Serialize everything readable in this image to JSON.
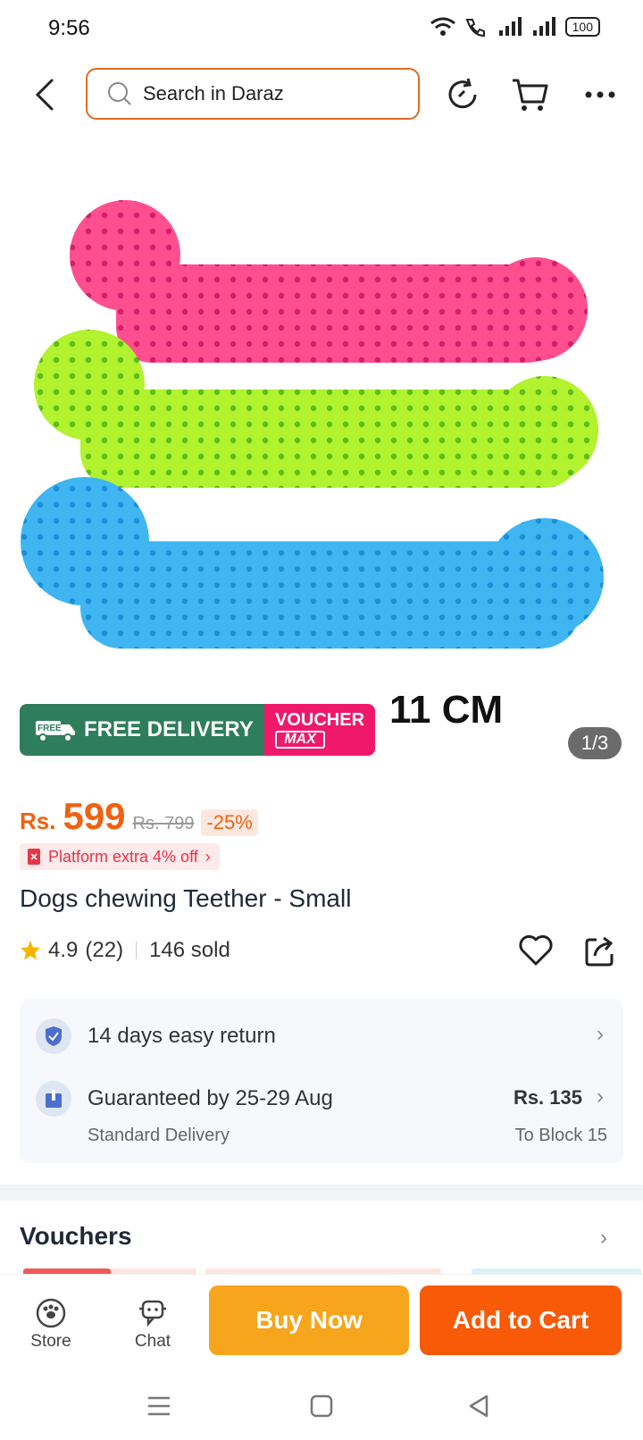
{
  "status_bar": {
    "time": "9:56",
    "battery": "100"
  },
  "header": {
    "search_placeholder": "Search in Daraz"
  },
  "image": {
    "promo_free_label": "FREE DELIVERY",
    "promo_free_badge": "FREE",
    "voucher_top": "VOUCHER",
    "voucher_bottom": "MAX",
    "size_text": "11 CM",
    "counter": "1/3"
  },
  "price": {
    "currency": "Rs.",
    "value": "599",
    "original": "Rs. 799",
    "discount": "-25%"
  },
  "platform_tag": "Platform extra 4% off",
  "product": {
    "title": "Dogs chewing Teether - Small"
  },
  "rating": {
    "score": "4.9",
    "count": "(22)",
    "sold": "146 sold"
  },
  "service": {
    "return_text": "14 days easy return",
    "delivery_text": "Guaranteed by 25-29 Aug",
    "delivery_sub": "Standard Delivery",
    "delivery_price": "Rs. 135",
    "delivery_to": "To Block 15"
  },
  "vouchers": {
    "title": "Vouchers"
  },
  "bottom_bar": {
    "store": "Store",
    "chat": "Chat",
    "buy_now": "Buy Now",
    "add_to_cart": "Add to Cart"
  },
  "colors": {
    "accent": "#f85a08",
    "buy_now": "#f7a51c",
    "price": "#f06110"
  }
}
